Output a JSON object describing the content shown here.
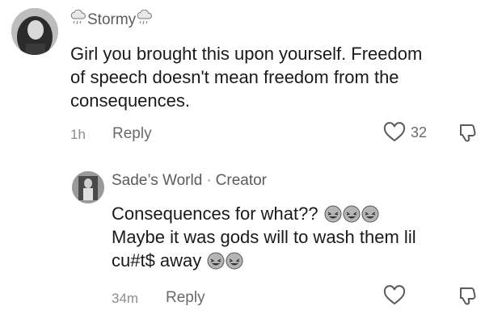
{
  "comment": {
    "username": "Stormy",
    "username_decoration": "cloud-with-rain-icon",
    "lines": [
      "Girl you brought this upon yourself. Freedom",
      "of speech doesn't mean freedom from the",
      "consequences."
    ],
    "time": "1h",
    "reply_label": "Reply",
    "like_count": "32"
  },
  "reply_comment": {
    "username": "Sade’s World",
    "separator": "·",
    "badge": "Creator",
    "lines": [
      "Consequences for what??",
      "Maybe it was gods will to wash them lil",
      "cu#t$ away"
    ],
    "line1_emojis": [
      "rolling-laughing-icon",
      "rolling-laughing-icon",
      "rolling-laughing-icon"
    ],
    "line3_emojis": [
      "rolling-laughing-icon",
      "rolling-laughing-icon"
    ],
    "time": "34m",
    "reply_label": "Reply"
  },
  "colors": {
    "text": "#1a1a1a",
    "secondary": "#5c5c5c",
    "muted": "#8c8c8c"
  }
}
